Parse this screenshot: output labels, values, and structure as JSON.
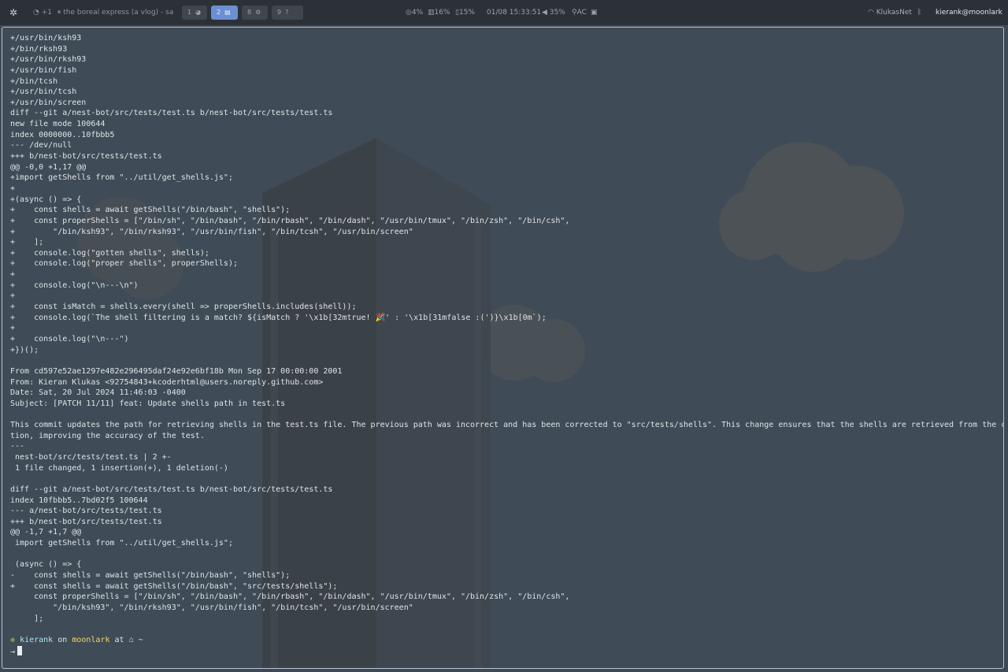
{
  "topbar": {
    "gear_icon": "gear-icon",
    "media": {
      "source": "+1",
      "state": "⏸",
      "title": "the boreal express (a vlog) - savi..."
    },
    "workspaces": [
      {
        "num": "1",
        "icon": "◕",
        "active": false
      },
      {
        "num": "2",
        "icon": "▤",
        "active": true
      },
      {
        "num": "8",
        "icon": "⚙",
        "active": false
      },
      {
        "num": "9",
        "icon": "?",
        "active": false
      }
    ],
    "stats": {
      "cpu": "4%",
      "mem": "16%",
      "disk": "15%",
      "datetime": "01/08 15:33:51",
      "volume": "35%",
      "power": "AC"
    },
    "network": "KlukasNet",
    "user_host": "kierank@moonlark"
  },
  "terminal": {
    "lines": [
      "+/usr/bin/ksh93",
      "+/bin/rksh93",
      "+/usr/bin/rksh93",
      "+/usr/bin/fish",
      "+/bin/tcsh",
      "+/usr/bin/tcsh",
      "+/usr/bin/screen",
      "diff --git a/nest-bot/src/tests/test.ts b/nest-bot/src/tests/test.ts",
      "new file mode 100644",
      "index 0000000..10fbbb5",
      "--- /dev/null",
      "+++ b/nest-bot/src/tests/test.ts",
      "@@ -0,0 +1,17 @@",
      "+import getShells from \"../util/get_shells.js\";",
      "+",
      "+(async () => {",
      "+    const shells = await getShells(\"/bin/bash\", \"shells\");",
      "+    const properShells = [\"/bin/sh\", \"/bin/bash\", \"/bin/rbash\", \"/bin/dash\", \"/usr/bin/tmux\", \"/bin/zsh\", \"/bin/csh\",",
      "+        \"/bin/ksh93\", \"/bin/rksh93\", \"/usr/bin/fish\", \"/bin/tcsh\", \"/usr/bin/screen\"",
      "+    ];",
      "+    console.log(\"gotten shells\", shells);",
      "+    console.log(\"proper shells\", properShells);",
      "+",
      "+    console.log(\"\\n---\\n\")",
      "+",
      "+    const isMatch = shells.every(shell => properShells.includes(shell));",
      "+    console.log(`The shell filtering is a match? ${isMatch ? '\\x1b[32mtrue! 🎉' : '\\x1b[31mfalse :(')}\\x1b[0m`);",
      "+",
      "+    console.log(\"\\n---\")",
      "+})();",
      "",
      "From cd597e52ae1297e482e296495daf24e92e6bf18b Mon Sep 17 00:00:00 2001",
      "From: Kieran Klukas <92754843+kcoderhtml@users.noreply.github.com>",
      "Date: Sat, 20 Jul 2024 11:46:03 -0400",
      "Subject: [PATCH 11/11] feat: Update shells path in test.ts",
      "",
      "This commit updates the path for retrieving shells in the test.ts file. The previous path was incorrect and has been corrected to \"src/tests/shells\". This change ensures that the shells are retrieved from the correct loca",
      "tion, improving the accuracy of the test.",
      "---",
      " nest-bot/src/tests/test.ts | 2 +-",
      " 1 file changed, 1 insertion(+), 1 deletion(-)",
      "",
      "diff --git a/nest-bot/src/tests/test.ts b/nest-bot/src/tests/test.ts",
      "index 10fbbb5..7bd02f5 100644",
      "--- a/nest-bot/src/tests/test.ts",
      "+++ b/nest-bot/src/tests/test.ts",
      "@@ -1,7 +1,7 @@",
      " import getShells from \"../util/get_shells.js\";",
      "",
      " (async () => {",
      "-    const shells = await getShells(\"/bin/bash\", \"shells\");",
      "+    const shells = await getShells(\"/bin/bash\", \"src/tests/shells\");",
      "     const properShells = [\"/bin/sh\", \"/bin/bash\", \"/bin/rbash\", \"/bin/dash\", \"/usr/bin/tmux\", \"/bin/zsh\", \"/bin/csh\",",
      "         \"/bin/ksh93\", \"/bin/rksh93\", \"/usr/bin/fish\", \"/bin/tcsh\", \"/usr/bin/screen\"",
      "     ];",
      ""
    ],
    "prompt": {
      "star": "✲",
      "user": "kierank",
      "on": "on",
      "host": "moonlark",
      "at": "at",
      "home_icon": "⌂",
      "dir": "~",
      "arrow": "→"
    }
  },
  "colors": {
    "background": "#3d4a55",
    "text": "#dfe4e8",
    "accent": "#6b8fd2",
    "prompt_user": "#a7e4f3",
    "prompt_host": "#f0d66a"
  }
}
